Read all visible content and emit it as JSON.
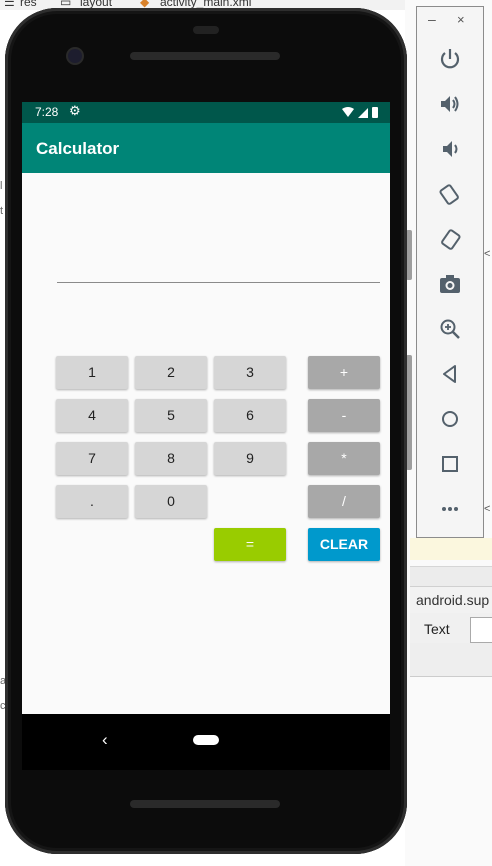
{
  "ide": {
    "breadcrumb_res": "res",
    "breadcrumb_layout": "layout",
    "breadcrumb_file": "activity_main.xml",
    "class_label": "android.sup",
    "tab_text": "Text"
  },
  "status_bar": {
    "time": "7:28"
  },
  "app": {
    "title": "Calculator"
  },
  "keypad": {
    "one": "1",
    "two": "2",
    "three": "3",
    "plus": "+",
    "four": "4",
    "five": "5",
    "six": "6",
    "minus": "-",
    "seven": "7",
    "eight": "8",
    "nine": "9",
    "multiply": "*",
    "dot": ".",
    "zero": "0",
    "divide": "/",
    "equals": "=",
    "clear": "CLEAR"
  },
  "nav": {
    "back": "‹"
  },
  "emulator_toolbar": {
    "minimize": "–",
    "close": "×",
    "tools": [
      "power-icon",
      "volume-up-icon",
      "volume-down-icon",
      "rotate-left-icon",
      "rotate-right-icon",
      "camera-icon",
      "zoom-icon",
      "back-icon",
      "home-icon",
      "overview-icon",
      "more-icon"
    ]
  },
  "colors": {
    "status_bar": "#00574b",
    "app_bar": "#008577",
    "digit_button": "#d6d6d6",
    "operator_button": "#a8a8a8",
    "equals_button": "#99cc00",
    "clear_button": "#0099cc"
  }
}
